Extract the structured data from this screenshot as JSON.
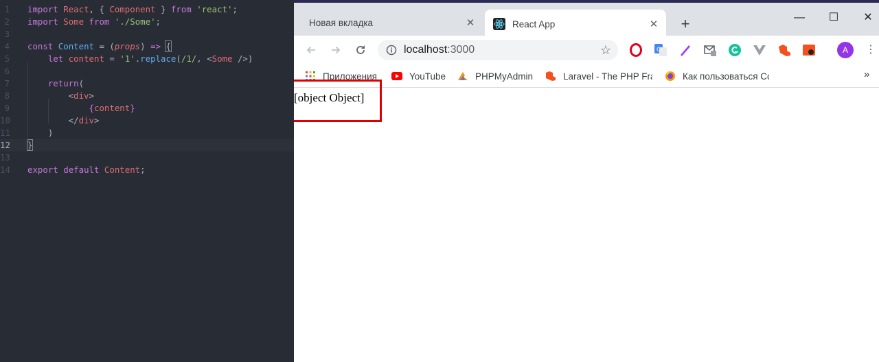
{
  "editor": {
    "lines": [
      {
        "n": "1",
        "tokens": [
          [
            "keyword",
            "import"
          ],
          [
            "plain",
            " "
          ],
          [
            "var",
            "React"
          ],
          [
            "plain",
            ", { "
          ],
          [
            "var",
            "Component"
          ],
          [
            "plain",
            " } "
          ],
          [
            "keyword",
            "from"
          ],
          [
            "plain",
            " "
          ],
          [
            "string",
            "'react'"
          ],
          [
            "plain",
            ";"
          ]
        ]
      },
      {
        "n": "2",
        "tokens": [
          [
            "keyword",
            "import"
          ],
          [
            "plain",
            " "
          ],
          [
            "var",
            "Some"
          ],
          [
            "plain",
            " "
          ],
          [
            "keyword",
            "from"
          ],
          [
            "plain",
            " "
          ],
          [
            "string",
            "'./Some'"
          ],
          [
            "plain",
            ";"
          ]
        ]
      },
      {
        "n": "3",
        "tokens": []
      },
      {
        "n": "4",
        "tokens": [
          [
            "keyword",
            "const"
          ],
          [
            "plain",
            " "
          ],
          [
            "func",
            "Content"
          ],
          [
            "plain",
            " = ("
          ],
          [
            "param",
            "props"
          ],
          [
            "plain",
            ") "
          ],
          [
            "keyword",
            "=>"
          ],
          [
            "plain",
            " "
          ],
          [
            "bracket",
            "{"
          ]
        ]
      },
      {
        "n": "5",
        "tokens": [
          [
            "plain",
            "    "
          ],
          [
            "keyword",
            "let"
          ],
          [
            "plain",
            " "
          ],
          [
            "var",
            "content"
          ],
          [
            "plain",
            " = "
          ],
          [
            "string",
            "'1'"
          ],
          [
            "plain",
            "."
          ],
          [
            "func",
            "replace"
          ],
          [
            "plain",
            "("
          ],
          [
            "string",
            "/1/"
          ],
          [
            "plain",
            ", <"
          ],
          [
            "var",
            "Some"
          ],
          [
            "plain",
            " />)"
          ]
        ]
      },
      {
        "n": "6",
        "tokens": []
      },
      {
        "n": "7",
        "tokens": [
          [
            "plain",
            "    "
          ],
          [
            "keyword",
            "return"
          ],
          [
            "plain",
            "("
          ]
        ]
      },
      {
        "n": "8",
        "tokens": [
          [
            "plain",
            "        <"
          ],
          [
            "var",
            "div"
          ],
          [
            "plain",
            ">"
          ]
        ]
      },
      {
        "n": "9",
        "tokens": [
          [
            "plain",
            "            "
          ],
          [
            "keyword",
            "{"
          ],
          [
            "var",
            "content"
          ],
          [
            "keyword",
            "}"
          ]
        ]
      },
      {
        "n": "10",
        "tokens": [
          [
            "plain",
            "        </"
          ],
          [
            "var",
            "div"
          ],
          [
            "plain",
            ">"
          ]
        ]
      },
      {
        "n": "11",
        "tokens": [
          [
            "plain",
            "    )"
          ]
        ]
      },
      {
        "n": "12",
        "tokens": [
          [
            "bracket",
            "}"
          ]
        ],
        "current": true
      },
      {
        "n": "13",
        "tokens": []
      },
      {
        "n": "14",
        "tokens": [
          [
            "keyword",
            "export"
          ],
          [
            "plain",
            " "
          ],
          [
            "keyword",
            "default"
          ],
          [
            "plain",
            " "
          ],
          [
            "var",
            "Content"
          ],
          [
            "plain",
            ";"
          ]
        ]
      }
    ]
  },
  "browser": {
    "tabs": [
      {
        "title": "Новая вкладка",
        "active": false
      },
      {
        "title": "React App",
        "active": true
      }
    ],
    "newtab_label": "+",
    "window_controls": {
      "minimize": "—",
      "maximize": "☐",
      "close": "✕"
    },
    "omnibox": {
      "host": "localhost",
      "port": ":3000"
    },
    "avatar_letter": "A",
    "bookmarks": [
      {
        "label": "Приложения",
        "icon": "apps-grid-icon"
      },
      {
        "label": "YouTube",
        "icon": "youtube-icon"
      },
      {
        "label": "PHPMyAdmin",
        "icon": "phpmyadmin-icon"
      },
      {
        "label": "Laravel - The PHP Fra",
        "icon": "laravel-icon"
      },
      {
        "label": "Как пользоваться Co",
        "icon": "firefox-icon"
      }
    ],
    "bookmarks_more": "»",
    "page_text": "[object Object]"
  },
  "colors": {
    "editor_bg": "#282c34",
    "highlight_box": "#e00000",
    "avatar": "#9334e6"
  }
}
